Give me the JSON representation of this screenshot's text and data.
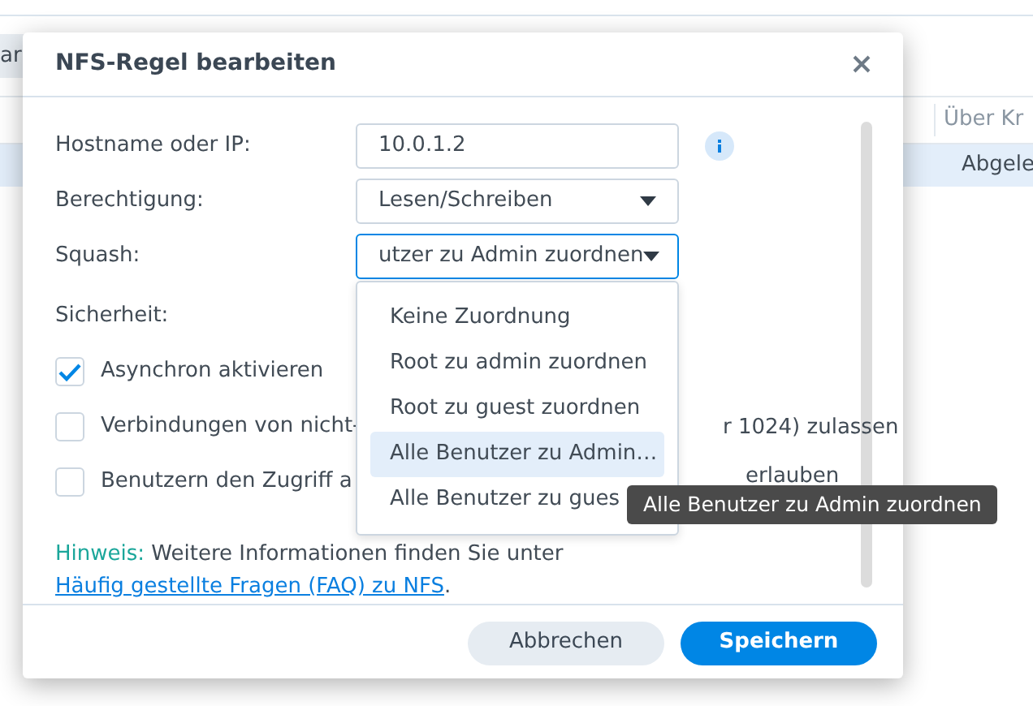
{
  "background": {
    "toolbar_button": "ar",
    "table_header": "Über Kr",
    "table_cell": "Abgele"
  },
  "dialog": {
    "title": "NFS-Regel bearbeiten",
    "fields": [
      {
        "kind": "text",
        "label": "Hostname oder IP:",
        "value": "10.0.1.2",
        "info": true,
        "focused": false
      },
      {
        "kind": "select",
        "label": "Berechtigung:",
        "value": "Lesen/Schreiben",
        "info": false,
        "focused": false
      },
      {
        "kind": "select",
        "label": "Squash:",
        "value": "utzer zu Admin zuordnen",
        "info": false,
        "focused": true
      }
    ],
    "section_label": "Sicherheit:",
    "checkboxes": [
      {
        "text": "Asynchron aktivieren",
        "checked": true
      },
      {
        "text": "Verbindungen von nicht-",
        "text_after": "r 1024) zulassen",
        "checked": false
      },
      {
        "text": "Benutzern den Zugriff a",
        "text_after": "erlauben",
        "checked": false
      }
    ],
    "dropdown": [
      {
        "label": "Keine Zuordnung",
        "selected": false
      },
      {
        "label": "Root zu admin zuordnen",
        "selected": false
      },
      {
        "label": "Root zu guest zuordnen",
        "selected": false
      },
      {
        "label": "Alle Benutzer zu Admin…",
        "selected": true
      },
      {
        "label": "Alle Benutzer zu gues",
        "selected": false
      }
    ],
    "tooltip": "Alle Benutzer zu Admin zuordnen",
    "note": {
      "label": "Hinweis:",
      "text": "Weitere Informationen finden Sie unter",
      "link": "Häufig gestellte Fragen (FAQ) zu NFS",
      "end": "."
    },
    "buttons": [
      {
        "label": "Abbrechen",
        "kind": "secondary"
      },
      {
        "label": "Speichern",
        "kind": "primary"
      }
    ]
  }
}
